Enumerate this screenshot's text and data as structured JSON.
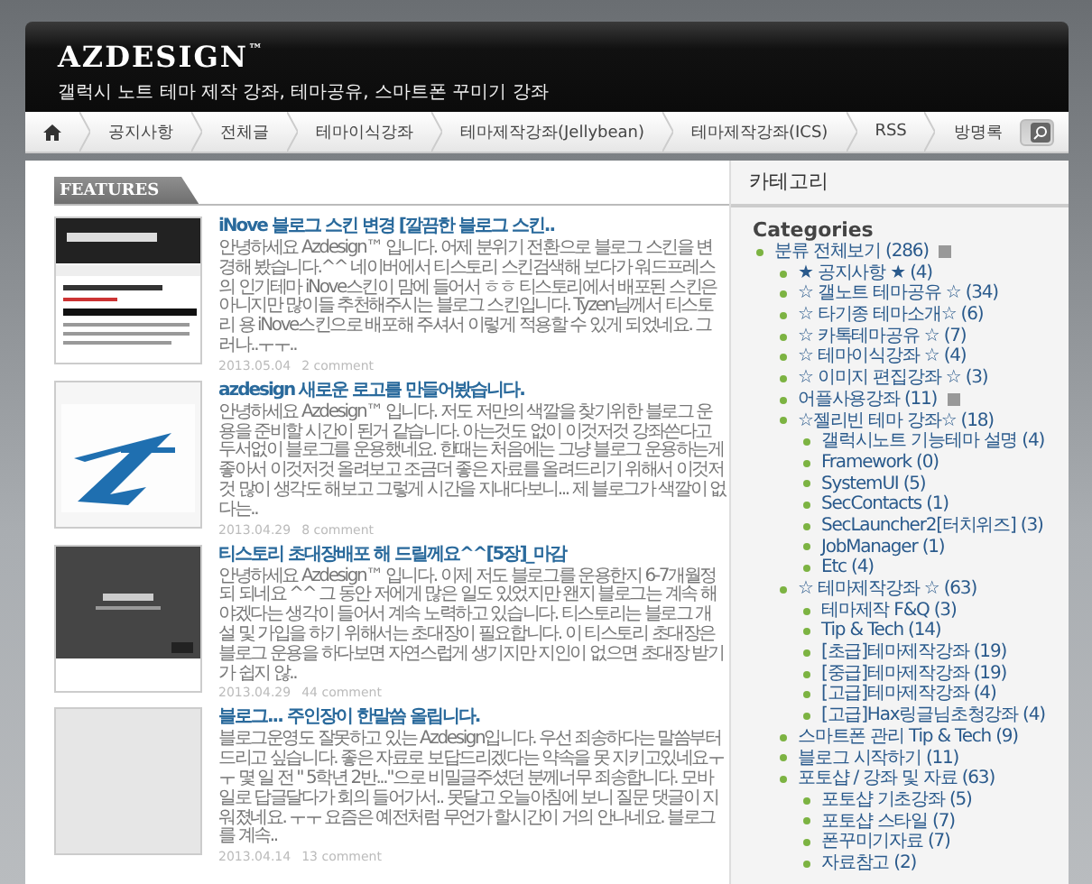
{
  "header": {
    "logo": "AZDESIGN",
    "logo_mark": "™",
    "tagline": "갤럭시 노트 테마 제작 강좌, 테마공유, 스마트폰 꾸미기 강좌"
  },
  "nav": {
    "items": [
      {
        "label": "공지사항"
      },
      {
        "label": "전체글"
      },
      {
        "label": "테마이식강좌"
      },
      {
        "label": "테마제작강좌(Jellybean)"
      },
      {
        "label": "테마제작강좌(ICS)"
      },
      {
        "label": "RSS"
      },
      {
        "label": "방명록"
      }
    ]
  },
  "features": {
    "heading": "FEATURES",
    "posts": [
      {
        "title": "iNove 블로그 스킨 변경 [깔끔한 블로그 스킨..",
        "excerpt": "안녕하세요 Azdesign™ 입니다. 어제 분위기 전환으로 블로그 스킨을 변경해 봤습니다.^^ 네이버에서 티스토리 스킨검색해 보다가 워드프레스의 인기테마 iNove스킨이 맘에 들어서 ㅎㅎ 티스토리에서 배포된 스킨은 아니지만 많이들 추천해주시는 블로그 스킨입니다. Tyzen님께서 티스토리 용 iNove스킨으로 배포해 주셔서 이렇게 적용할 수 있게 되었네요. 그러나..ㅜㅜ..",
        "date": "2013.05.04",
        "comments": "2 comment",
        "kind": "picture"
      },
      {
        "title": "azdesign 새로운 로고를 만들어봤습니다.",
        "excerpt": "안녕하세요 Azdesign™ 입니다. 저도 저만의 색깔을 찾기위한 블로그 운용을 준비할 시간이 된거 같습니다. 아는것도 없이 이것저것 강좌쓴다고 두서없이 블로그를 운용했네요. 한때는 처음에는 그냥 블로그 운용하는게 좋아서 이것저것 올려보고 조금더 좋은 자료를 올려드리기 위해서 이것저것 많이 생각도 해보고 그렇게 시간을 지내다보니... 제 블로그가 색깔이 없다는..",
        "date": "2013.04.29",
        "comments": "8 comment",
        "kind": "picture"
      },
      {
        "title": "티스토리 초대장배포 해 드릴께요^^[5장]_마감",
        "excerpt": "안녕하세요 Azdesign™ 입니다. 이제 저도 블로그를 운용한지 6-7개월정되 되네요 ^^ 그 동안 저에게 많은 일도 있었지만 왠지 블로그는 계속 해야겠다는 생각이 들어서 계속 노력하고 있습니다. 티스토리는 블로그 개설 및 가입을 하기 위해서는 초대장이 필요합니다. 이 티스토리 초대장은 블로그 운용을 하다보면 자연스럽게 생기지만 지인이 없으면 초대장 받기가 쉽지 않..",
        "date": "2013.04.29",
        "comments": "44 comment",
        "kind": "picture"
      },
      {
        "title": "블로그... 주인장이 한말씀 올립니다.",
        "excerpt": "블로그운영도 잘못하고 있는 Azdesign입니다. 우선 죄송하다는 말씀부터드리고 싶습니다. 좋은 자료로 보답드리겠다는 약속을 못 지키고있네요ㅜㅜ 몇 일 전 \" 5학년 2반...\"으로 비밀글주셨던 분께너무 죄송합니다. 모바일로 답글달다가 회의 들어가서.. 못달고 오늘아침에 보니 질문 댓글이 지워졌네요. ㅜㅜ 요즘은 예전처럼 무언가 할시간이 거의 안나네요. 블로그를 계속..",
        "date": "2013.04.14",
        "comments": "13 comment"
      }
    ]
  },
  "sidebar": {
    "title": "카테고리",
    "heading": "Categories",
    "tree": [
      {
        "label": "분류 전체보기 (286)",
        "new": true,
        "children": [
          {
            "label": "★ 공지사항 ★ (4)",
            "new": false
          },
          {
            "label": "☆ 갤노트 테마공유 ☆ (34)",
            "new": false
          },
          {
            "label": "☆ 타기종 테마소개☆ (6)",
            "new": false
          },
          {
            "label": "☆ 카톡테마공유 ☆ (7)",
            "new": false
          },
          {
            "label": "☆ 테마이식강좌 ☆ (4)",
            "new": false
          },
          {
            "label": "☆ 이미지 편집강좌 ☆ (3)",
            "new": false
          },
          {
            "label": "어플사용강좌 (11)",
            "new": true
          },
          {
            "label": "☆젤리빈 테마 강좌☆ (18)",
            "new": false,
            "children": [
              {
                "label": "갤럭시노트 기능테마 설명 (4)",
                "new": false
              },
              {
                "label": "Framework (0)",
                "new": false
              },
              {
                "label": "SystemUI (5)",
                "new": false
              },
              {
                "label": "SecContacts (1)",
                "new": false
              },
              {
                "label": "SecLauncher2[터치위즈] (3)",
                "new": false
              },
              {
                "label": "JobManager (1)",
                "new": false
              },
              {
                "label": "Etc (4)",
                "new": false
              }
            ]
          },
          {
            "label": "☆ 테마제작강좌 ☆ (63)",
            "new": false,
            "children": [
              {
                "label": "테마제작 F&Q (3)",
                "new": false
              },
              {
                "label": "Tip & Tech (14)",
                "new": false
              },
              {
                "label": "[초급]테마제작강좌 (19)",
                "new": false
              },
              {
                "label": "[중급]테마제작강좌 (19)",
                "new": false
              },
              {
                "label": "[고급]테마제작강좌 (4)",
                "new": false
              },
              {
                "label": "[고급]Hax링글님초청강좌 (4)",
                "new": false
              }
            ]
          },
          {
            "label": "스마트폰 관리 Tip & Tech (9)",
            "new": false
          },
          {
            "label": "블로그 시작하기 (11)",
            "new": false
          },
          {
            "label": "포토샵 / 강좌 및 자료 (63)",
            "new": false,
            "children": [
              {
                "label": "포토샵 기초강좌 (5)",
                "new": false
              },
              {
                "label": "포토샵 스타일 (7)",
                "new": false
              },
              {
                "label": "폰꾸미기자료 (7)",
                "new": false
              },
              {
                "label": "자료참고 (2)",
                "new": false
              }
            ]
          }
        ]
      }
    ]
  }
}
